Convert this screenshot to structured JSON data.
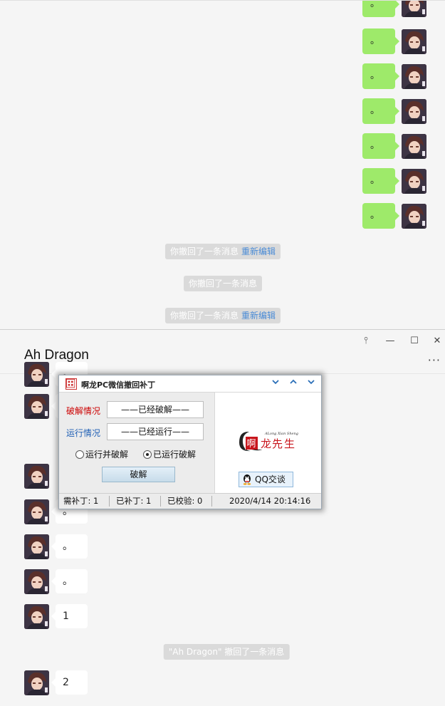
{
  "top_pane": {
    "outgoing_messages": [
      {
        "text": "。"
      },
      {
        "text": "。"
      },
      {
        "text": "。"
      },
      {
        "text": "。"
      },
      {
        "text": "。"
      },
      {
        "text": "。"
      },
      {
        "text": "。"
      }
    ],
    "system_notices": [
      {
        "text": "你撤回了一条消息",
        "link": "重新编辑"
      },
      {
        "text": "你撤回了一条消息",
        "link": ""
      },
      {
        "text": "你撤回了一条消息",
        "link": "重新编辑"
      }
    ]
  },
  "chat_window": {
    "title": "Ah Dragon",
    "window_controls": {
      "pin": "⫯",
      "minimize": "—",
      "maximize": "☐",
      "close": "✕"
    },
    "more_label": "···",
    "incoming_messages": [
      {
        "text": "。"
      },
      {
        "text": "。"
      },
      {
        "text": "。"
      },
      {
        "text": "。"
      },
      {
        "text": "。"
      },
      {
        "text": "。"
      },
      {
        "text": "1"
      }
    ],
    "recall_notice": "\"Ah Dragon\" 撤回了一条消息",
    "last_message": {
      "text": "2"
    }
  },
  "patch_dialog": {
    "logo_text": "啊龍先生",
    "title": "啊龙PC微信撤回补丁",
    "crack_label": "破解情况",
    "crack_value": "——已经破解——",
    "run_label": "运行情况",
    "run_value": "——已经运行——",
    "radio_run_and_crack": "运行并破解",
    "radio_already_running": "已运行破解",
    "crack_button": "破解",
    "brand_text": "啊龙先生",
    "brand_sub": "ALong Xian Sheng",
    "qq_button": "QQ交谈",
    "status": {
      "need_patch": "需补丁: 1",
      "patched": "已补丁: 1",
      "verified": "已校验: 0",
      "datetime": "2020/4/14 20:14:16"
    },
    "colors": {
      "crack_label": "#cc0000",
      "run_label": "#1f5fb5",
      "brand_red": "#c8161d"
    }
  }
}
